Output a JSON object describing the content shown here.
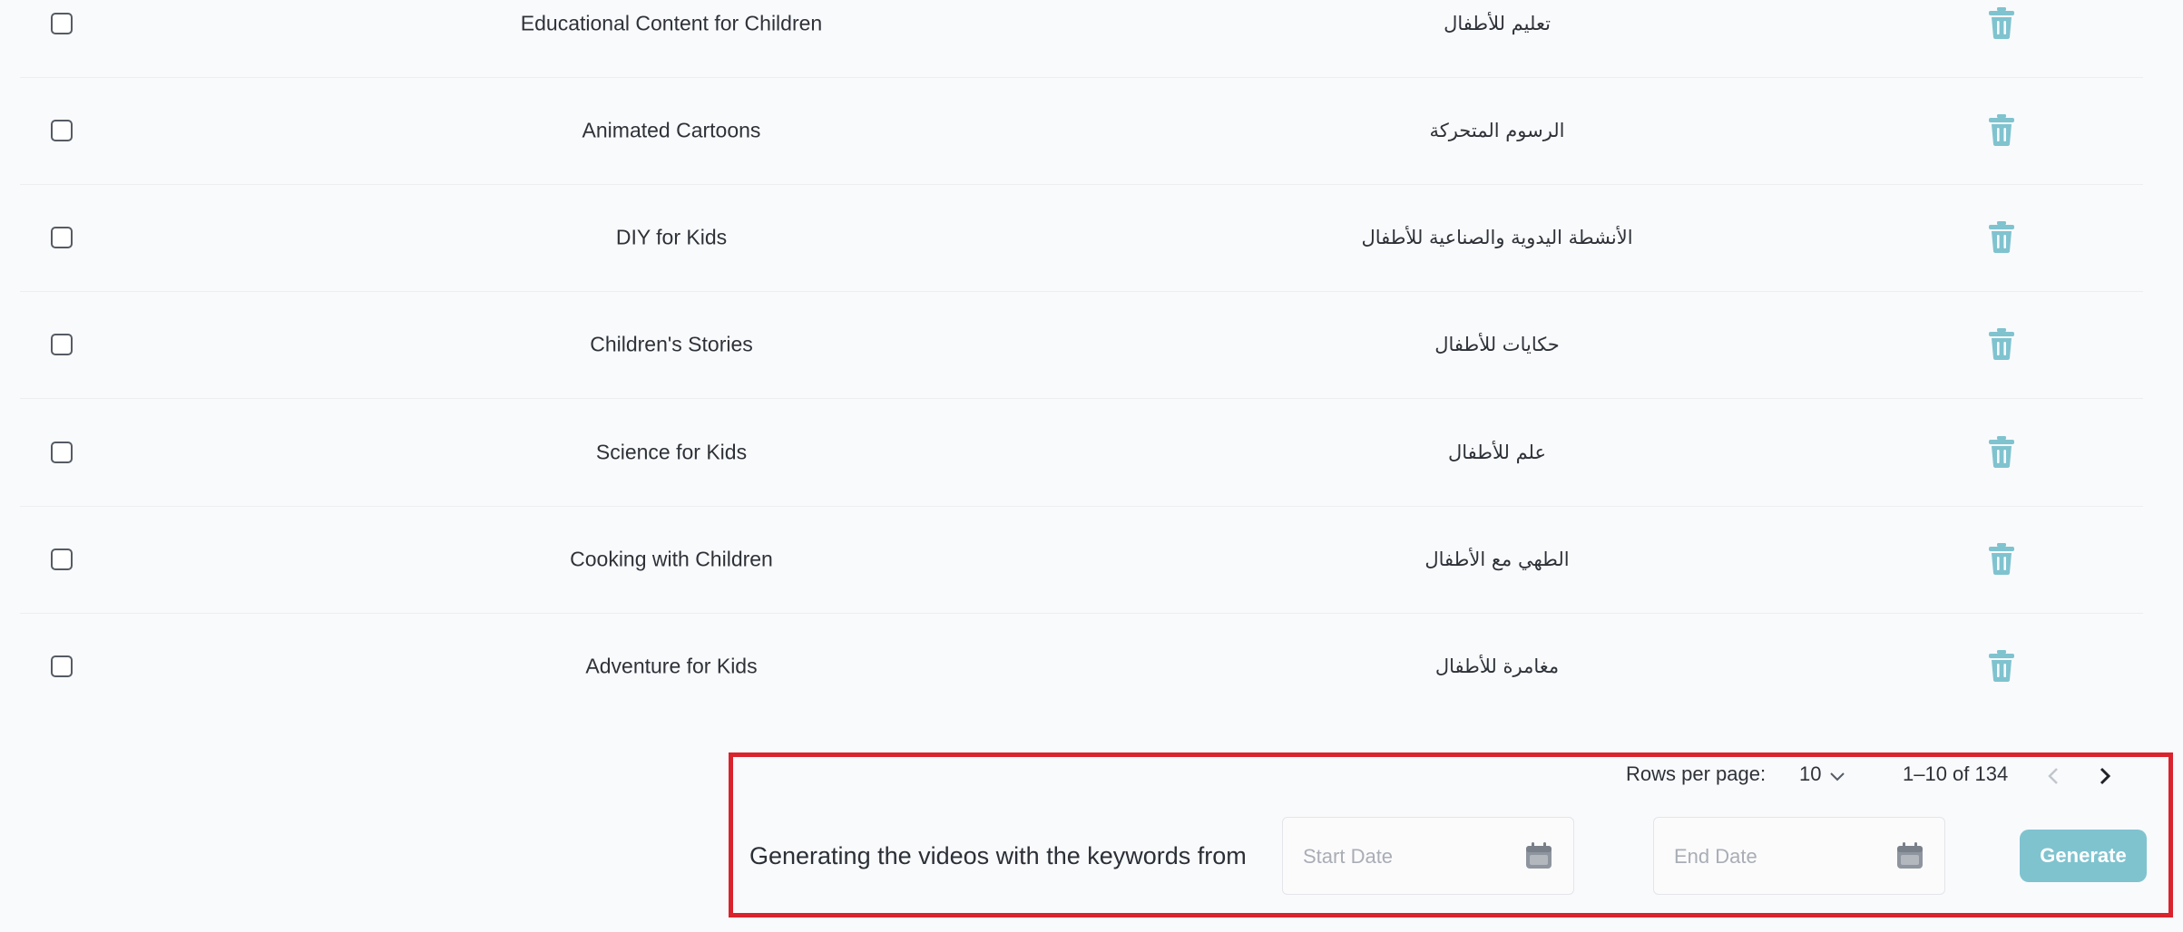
{
  "rows": [
    {
      "keyword_en": "Educational Content for Children",
      "keyword_ar": "تعليم للأطفال"
    },
    {
      "keyword_en": "Animated Cartoons",
      "keyword_ar": "الرسوم المتحركة"
    },
    {
      "keyword_en": "DIY for Kids",
      "keyword_ar": "الأنشطة اليدوية والصناعية للأطفال"
    },
    {
      "keyword_en": "Children's Stories",
      "keyword_ar": "حكايات للأطفال"
    },
    {
      "keyword_en": "Science for Kids",
      "keyword_ar": "علم للأطفال"
    },
    {
      "keyword_en": "Cooking with Children",
      "keyword_ar": "الطهي مع الأطفال"
    },
    {
      "keyword_en": "Adventure for Kids",
      "keyword_ar": "مغامرة للأطفال"
    }
  ],
  "pagination": {
    "rows_per_page_label": "Rows per page:",
    "rows_per_page_value": "10",
    "page_info": "1–10 of 134"
  },
  "generate": {
    "label": "Generating the videos with the keywords from",
    "start_placeholder": "Start Date",
    "end_placeholder": "End Date",
    "button_label": "Generate"
  },
  "colors": {
    "trash_icon": "#7fc3cf",
    "generate_button": "#7fc3cf",
    "highlight_border": "#d9232d"
  },
  "icons": {
    "row_delete": "trash-icon",
    "date_picker": "calendar-icon",
    "rows_dropdown": "chevron-down-icon",
    "prev_page": "chevron-left-icon",
    "next_page": "chevron-right-icon"
  }
}
